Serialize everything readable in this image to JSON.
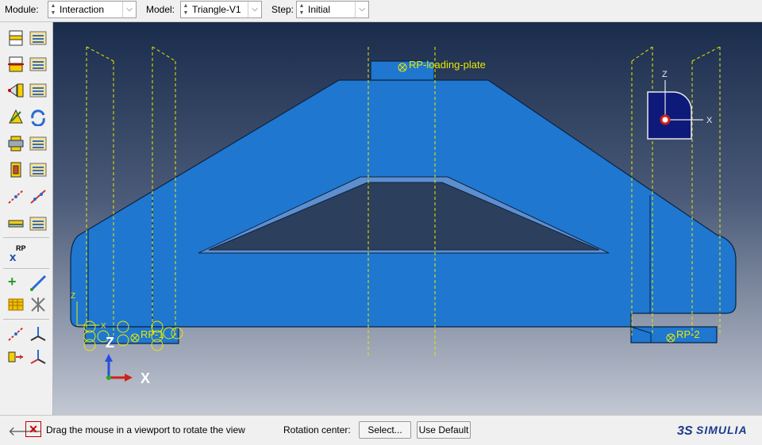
{
  "toolbar": {
    "module_label": "Module:",
    "module_value": "Interaction",
    "model_label": "Model:",
    "model_value": "Triangle-V1",
    "step_label": "Step:",
    "step_value": "Initial"
  },
  "left_toolbar": {
    "rp_tool_label": "RP"
  },
  "viewport": {
    "labels": {
      "loading_plate": "RP-loading-plate",
      "rp1": "RP-1",
      "rp2": "RP-2",
      "z": "Z",
      "x": "X"
    },
    "triad": {
      "z": "Z",
      "x": "X"
    },
    "compass": {
      "z": "Z",
      "x": "X"
    },
    "colors": {
      "part_fill": "#1f77d0",
      "part_edge": "#0a2342",
      "guide_lines": "#e8e800",
      "background_top": "#1a2c4c",
      "background_bottom": "#c3c8d3"
    }
  },
  "statusbar": {
    "prompt": "Drag the mouse in a viewport to rotate the view",
    "rotation_center_label": "Rotation center:",
    "select_button": "Select...",
    "use_default_button": "Use Default",
    "brand": "SIMULIA"
  }
}
